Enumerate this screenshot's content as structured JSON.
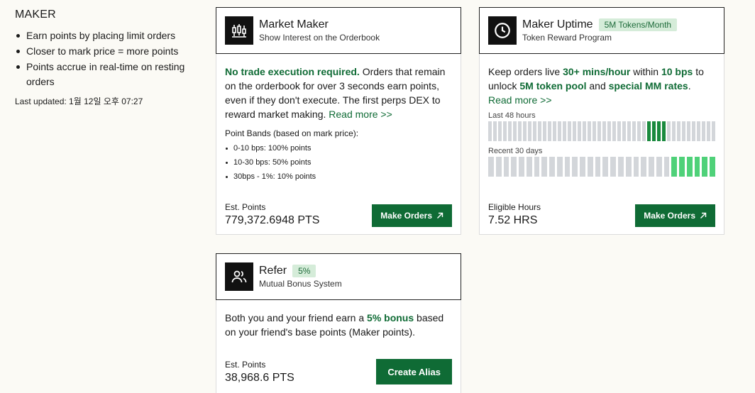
{
  "sidebar": {
    "title": "MAKER",
    "bullets": [
      "Earn points by placing limit orders",
      "Closer to mark price = more points",
      "Points accrue in real-time on resting orders"
    ],
    "last_updated": "Last updated: 1월 12일 오후 07:27"
  },
  "market_maker": {
    "icon": "candlestick-icon",
    "title": "Market Maker",
    "subtitle": "Show Interest on the Orderbook",
    "desc_highlight": "No trade execution required.",
    "desc_rest": " Orders that remain on the orderbook for over 3 seconds earn points, even if they don't execute. The first perps DEX to reward market making.",
    "read_more": "Read more >>",
    "bands_title": "Point Bands (based on mark price):",
    "bands": [
      "0-10 bps: 100% points",
      "10-30 bps: 50% points",
      "30bps - 1%: 10% points"
    ],
    "points_label": "Est. Points",
    "points_value": "779,372.6948 PTS",
    "button_label": "Make Orders"
  },
  "maker_uptime": {
    "icon": "clock-icon",
    "title": "Maker Uptime",
    "tag": "5M Tokens/Month",
    "subtitle": "Token Reward Program",
    "desc_1": "Keep orders live ",
    "desc_h1": "30+ mins/hour",
    "desc_2": " within ",
    "desc_h2": "10 bps",
    "desc_3": " to unlock ",
    "desc_h3": "5M token pool",
    "desc_4": " and ",
    "desc_h4": "special MM rates",
    "desc_5": ".",
    "read_more": "Read more >>",
    "hours_label": "Last 48 hours",
    "hours_active": [
      0,
      0,
      0,
      0,
      0,
      0,
      0,
      0,
      0,
      0,
      0,
      0,
      0,
      0,
      0,
      0,
      0,
      0,
      0,
      0,
      0,
      0,
      0,
      0,
      0,
      0,
      0,
      0,
      0,
      0,
      0,
      0,
      1,
      1,
      1,
      1,
      0,
      0,
      0,
      0,
      0,
      0,
      0,
      0,
      0,
      0,
      0,
      0,
      0,
      0,
      0,
      0,
      0,
      0,
      0,
      0,
      0,
      0,
      0,
      0,
      0,
      0,
      0,
      1,
      1,
      1,
      1,
      1,
      1,
      0,
      0
    ],
    "days_label": "Recent 30 days",
    "days_active": [
      0,
      0,
      0,
      0,
      0,
      0,
      0,
      0,
      0,
      0,
      0,
      0,
      0,
      0,
      0,
      0,
      0,
      0,
      0,
      0,
      0,
      0,
      0,
      0,
      1,
      1,
      1,
      1,
      1,
      1
    ],
    "hours_value_label": "Eligible Hours",
    "hours_value": "7.52 HRS",
    "button_label": "Make Orders"
  },
  "refer": {
    "icon": "users-icon",
    "title": "Refer",
    "tag": "5%",
    "subtitle": "Mutual Bonus System",
    "desc_1": "Both you and your friend earn a ",
    "desc_h": "5% bonus",
    "desc_2": " based on your friend's base points (Maker points).",
    "points_label": "Est. Points",
    "points_value": "38,968.6 PTS",
    "button_label": "Create Alias"
  },
  "colors": {
    "accent": "#0f6b35",
    "bar_dark": "#1a8a3e",
    "bar_light": "#4fd179",
    "bar_off": "#d3d6da"
  }
}
